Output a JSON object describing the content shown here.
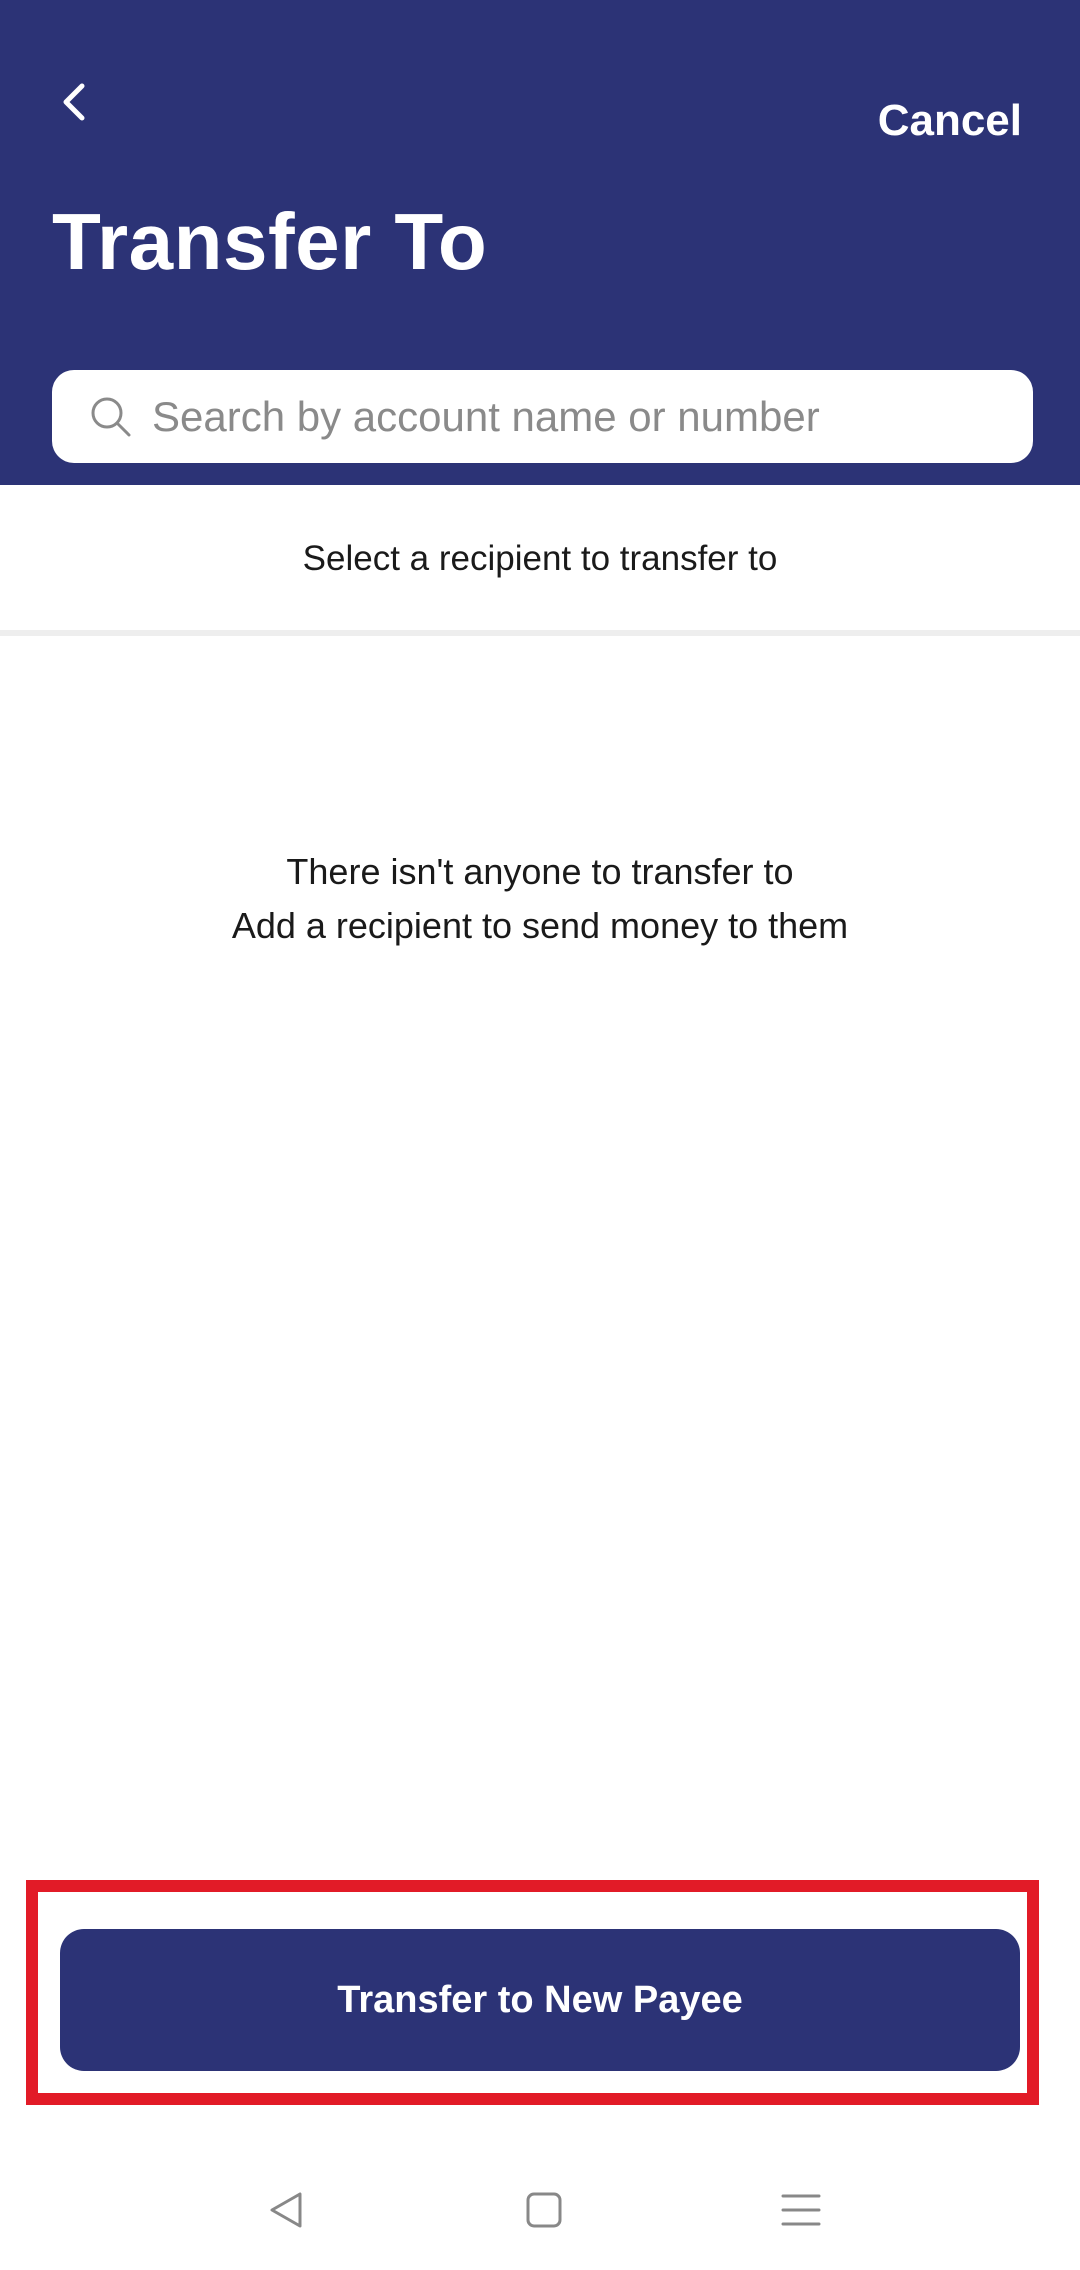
{
  "header": {
    "title": "Transfer To",
    "cancel_label": "Cancel",
    "back_icon": "chevron-left-icon",
    "background_color": "#2c3376"
  },
  "search": {
    "placeholder": "Search by account name or number",
    "value": "",
    "icon": "search-icon"
  },
  "main": {
    "subtitle": "Select a recipient to transfer to",
    "empty_line1": "There isn't anyone to transfer to",
    "empty_line2": "Add a recipient to send money to them"
  },
  "footer": {
    "primary_button_label": "Transfer to New Payee",
    "button_color": "#2c3376",
    "highlight_color": "#e21b27"
  },
  "nav": {
    "back_icon": "triangle-back-icon",
    "home_icon": "square-home-icon",
    "menu_icon": "menu-lines-icon"
  }
}
